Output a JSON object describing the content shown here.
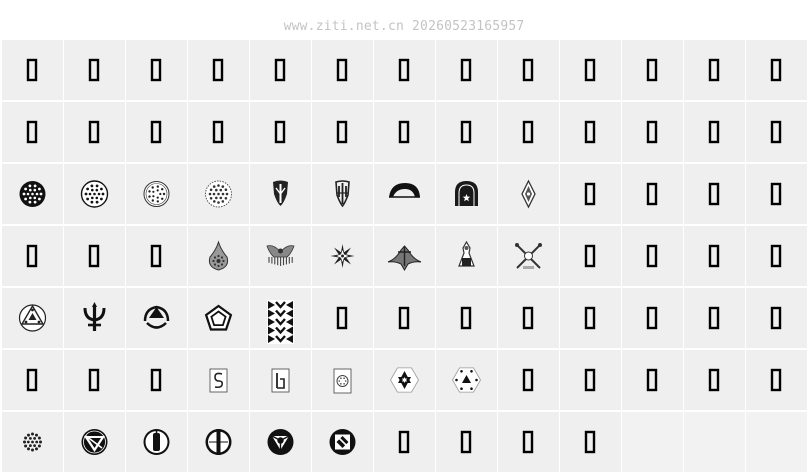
{
  "watermark": "www.ziti.net.cn 20260523165957",
  "grid": {
    "rows": [
      [
        "missing",
        "missing",
        "missing",
        "missing",
        "missing",
        "missing",
        "missing",
        "missing",
        "missing",
        "missing",
        "missing",
        "missing",
        "missing"
      ],
      [
        "missing",
        "missing",
        "missing",
        "missing",
        "missing",
        "missing",
        "missing",
        "missing",
        "missing",
        "missing",
        "missing",
        "missing",
        "missing"
      ],
      [
        "star-seal-filled",
        "star-seal-outline",
        "star-seal-light",
        "star-seal-dotted",
        "shield-emblem",
        "trident-shield-emblem",
        "arch-emblem",
        "gate-emblem",
        "diamond-emblem",
        "missing",
        "missing",
        "missing",
        "missing"
      ],
      [
        "missing",
        "missing",
        "missing",
        "drop-emblem",
        "winged-emblem",
        "compass-star-emblem",
        "ship-emblem",
        "figure-emblem",
        "crossed-emblem",
        "missing",
        "missing",
        "missing",
        "missing"
      ],
      [
        "triangle-circle-emblem",
        "trident-emblem",
        "arrow-circle-emblem",
        "pentagon-emblem",
        "pattern-tile-emblem",
        "missing",
        "missing",
        "missing",
        "missing",
        "missing",
        "missing",
        "missing",
        "missing"
      ],
      [
        "missing",
        "missing",
        "missing",
        "s-card-emblem",
        "bar-card-emblem",
        "seal-card-emblem",
        "hexagram-hexagon-emblem",
        "triangle-hexagon-emblem",
        "missing",
        "missing",
        "missing",
        "missing",
        "missing"
      ],
      [
        "dot-rosette-emblem",
        "triangle-disc-emblem",
        "bar-disc-emblem",
        "vertical-bar-disc-emblem",
        "trefoil-disc-emblem",
        "diamond-disc-emblem",
        "missing",
        "missing",
        "missing",
        "missing",
        "empty",
        "empty",
        "empty"
      ]
    ]
  }
}
